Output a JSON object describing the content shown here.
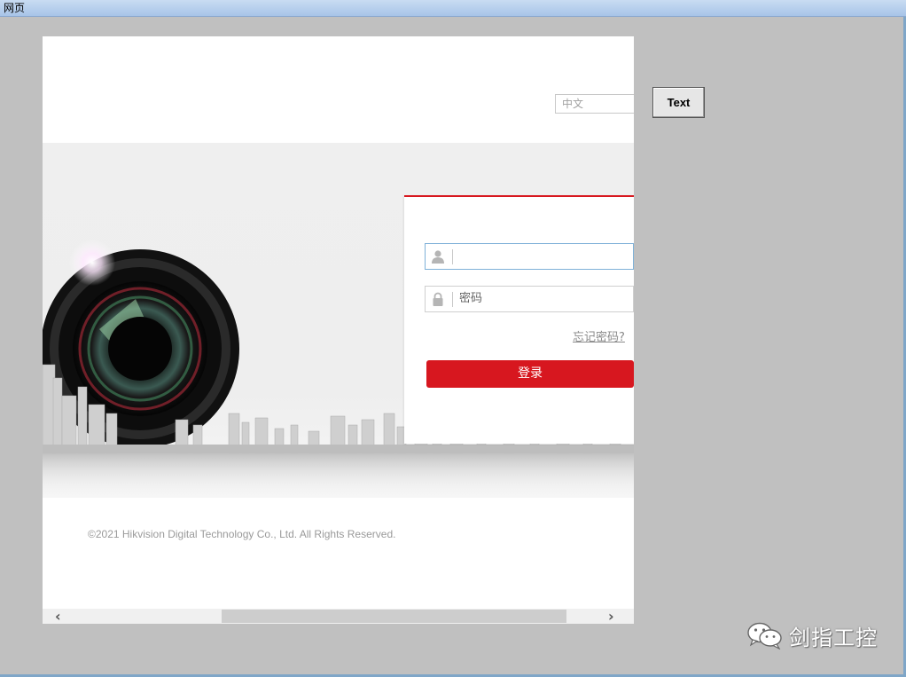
{
  "window": {
    "title": "网页"
  },
  "login_page": {
    "language_select": "中文",
    "username_field": {
      "value": ""
    },
    "password_field": {
      "placeholder": "密码"
    },
    "forgot_password_link": "忘记密码?",
    "login_button": "登录",
    "copyright": "©2021 Hikvision Digital Technology Co., Ltd. All Rights Reserved."
  },
  "side_button": {
    "label": "Text"
  },
  "watermark": {
    "text": "剑指工控",
    "icon": "wechat-icon"
  },
  "colors": {
    "brand_red": "#d7171f",
    "background_gray": "#c0c0c0"
  }
}
